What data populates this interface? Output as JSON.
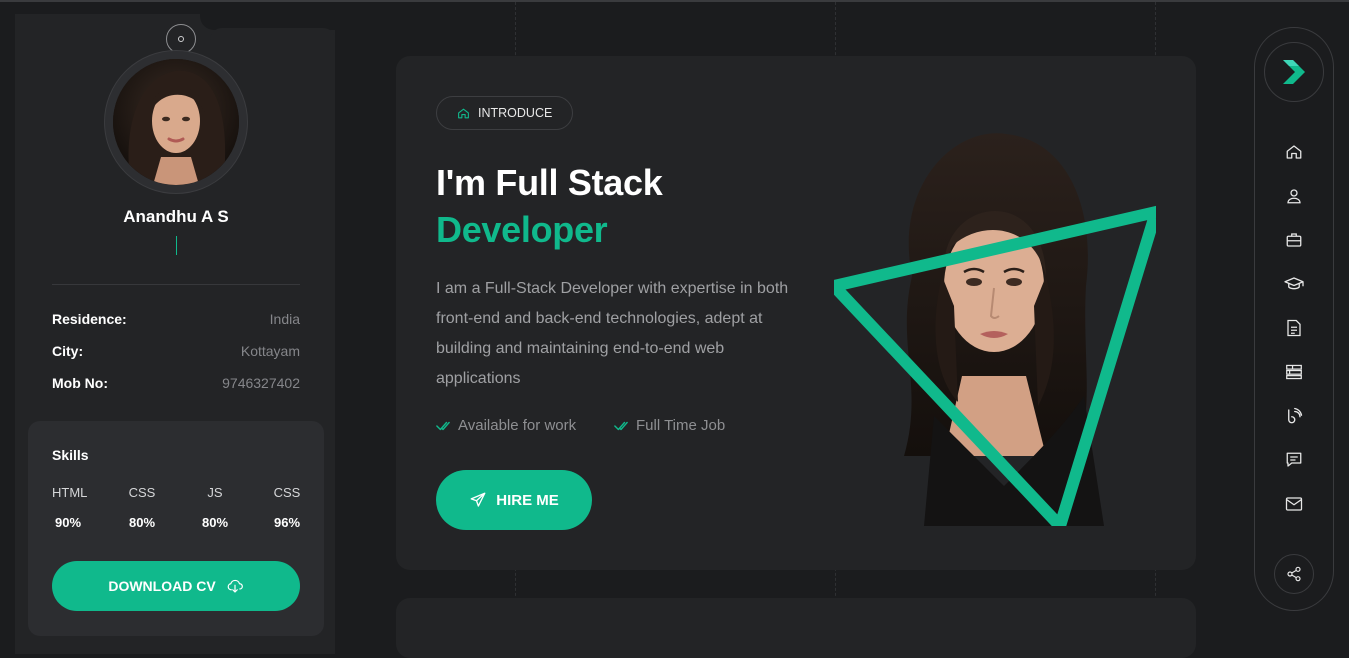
{
  "profile": {
    "name": "Anandhu A S",
    "info": [
      {
        "label": "Residence:",
        "value": "India"
      },
      {
        "label": "City:",
        "value": "Kottayam"
      },
      {
        "label": "Mob No:",
        "value": "9746327402"
      }
    ],
    "skills_title": "Skills",
    "skills": [
      {
        "name": "HTML",
        "percent": "90%"
      },
      {
        "name": "CSS",
        "percent": "80%"
      },
      {
        "name": "JS",
        "percent": "80%"
      },
      {
        "name": "CSS",
        "percent": "96%"
      }
    ],
    "download_label": "DOWNLOAD CV"
  },
  "hero": {
    "badge": "INTRODUCE",
    "title_line1": "I'm Full Stack",
    "title_line2": "Developer",
    "description": "I am a Full-Stack Developer with expertise in both front-end and back-end technologies, adept at building and maintaining end-to-end web applications",
    "checks": [
      "Available for work",
      "Full Time Job"
    ],
    "hire_label": "HIRE ME"
  },
  "nav": {
    "items": [
      "home-icon",
      "user-icon",
      "briefcase-icon",
      "graduation-cap-icon",
      "document-icon",
      "services-icon",
      "blog-icon",
      "chat-icon",
      "mail-icon"
    ],
    "share": "share-icon"
  },
  "colors": {
    "accent": "#10b98c",
    "background": "#1b1c1e",
    "card": "#232426"
  }
}
